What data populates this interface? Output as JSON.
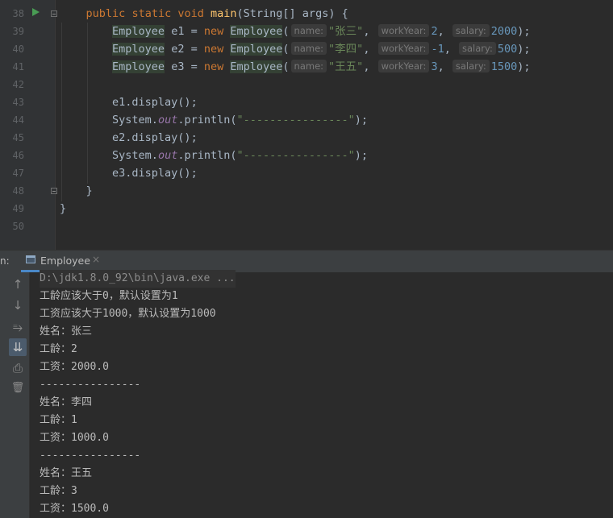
{
  "editor": {
    "line_numbers": [
      "38",
      "39",
      "40",
      "41",
      "42",
      "43",
      "44",
      "45",
      "46",
      "47",
      "48",
      "49",
      "50"
    ],
    "code": {
      "main_decl": {
        "kw1": "public",
        "kw2": "static",
        "kw3": "void",
        "fn": "main",
        "rest": "(String[] args) {"
      },
      "employees": [
        {
          "type": "Employee",
          "var": " e1 = ",
          "new": "new",
          "ctor": "Employee",
          "open": "(",
          "hint_name": "name:",
          "name": "\"张三\"",
          "hint_year": "workYear:",
          "year": "2",
          "hint_salary": "salary:",
          "salary": "2000",
          "close": ");"
        },
        {
          "type": "Employee",
          "var": " e2 = ",
          "new": "new",
          "ctor": "Employee",
          "open": "(",
          "hint_name": "name:",
          "name": "\"李四\"",
          "hint_year": "workYear:",
          "year": "-1",
          "hint_salary": "salary:",
          "salary": "500",
          "close": ");"
        },
        {
          "type": "Employee",
          "var": " e3 = ",
          "new": "new",
          "ctor": "Employee",
          "open": "(",
          "hint_name": "name:",
          "name": "\"王五\"",
          "hint_year": "workYear:",
          "year": "3",
          "hint_salary": "salary:",
          "salary": "1500",
          "close": ");"
        }
      ],
      "display1": "e1.display();",
      "display2": "e2.display();",
      "display3": "e3.display();",
      "println": {
        "pre": "System.",
        "out": "out",
        "mid": ".println(",
        "str": "\"----------------\"",
        "post": ");"
      },
      "close_method": "}",
      "close_class": "}"
    }
  },
  "run_panel": {
    "label": "n:",
    "tab_label": "Employee",
    "tab_close": "×",
    "toolbar": {
      "up_icon": "↑",
      "down_icon": "↓",
      "wrap_icon": "⥱",
      "scroll_icon": "⇊",
      "print_icon": "⎙",
      "trash_icon": "🗑"
    },
    "output": [
      "D:\\jdk1.8.0_92\\bin\\java.exe ...",
      "工龄应该大于0，默认设置为1",
      "工资应该大于1000，默认设置为1000",
      "姓名：张三",
      "工龄：2",
      "工资：2000.0",
      "----------------",
      "姓名：李四",
      "工龄：1",
      "工资：1000.0",
      "----------------",
      "姓名：王五",
      "工龄：3",
      "工资：1500.0"
    ]
  }
}
